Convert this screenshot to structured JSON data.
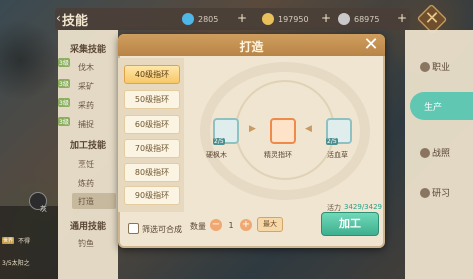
{
  "header": {
    "title": "技能",
    "back_glyph": "‹",
    "currencies": [
      {
        "icon": "diamond-icon",
        "value": "2805",
        "color": "#4fb6e8"
      },
      {
        "icon": "gold-coin-icon",
        "value": "197950",
        "color": "#e8c15a"
      },
      {
        "icon": "silver-coin-icon",
        "value": "68975",
        "color": "#c9c9c9"
      }
    ],
    "plus": "+",
    "close_glyph": "✕"
  },
  "left_menu": {
    "sections": [
      {
        "label": "采集技能",
        "items": [
          {
            "label": "伐木",
            "lv": "3级"
          },
          {
            "label": "采矿",
            "lv": "3级"
          },
          {
            "label": "采药",
            "lv": "3级"
          },
          {
            "label": "捕捉",
            "lv": "3级"
          }
        ]
      },
      {
        "label": "加工技能",
        "items": [
          {
            "label": "烹饪"
          },
          {
            "label": "炼药"
          },
          {
            "label": "打造"
          }
        ]
      },
      {
        "label": "通用技能",
        "items": [
          {
            "label": "钓鱼"
          }
        ]
      }
    ]
  },
  "right_tabs": [
    {
      "label": "职业",
      "icon": "profession-icon"
    },
    {
      "label": "生产",
      "icon": "production-icon",
      "active": true
    },
    {
      "label": "战照",
      "icon": "battle-icon"
    },
    {
      "label": "研习",
      "icon": "study-icon"
    }
  ],
  "chat": {
    "avatar_label": "灰",
    "lines": [
      {
        "tag": "世界",
        "text": "不得"
      },
      {
        "tag": "",
        "text": "3/5太阳之"
      }
    ]
  },
  "modal": {
    "title": "打造",
    "close": "✕",
    "rings": [
      "40级指环",
      "50级指环",
      "60级指环",
      "70级指环",
      "80级指环",
      "90级指环"
    ],
    "active_ring_index": 0,
    "materials": [
      {
        "name": "硬枫木",
        "count": "2/5",
        "icon": "wood-icon"
      },
      {
        "name": "精灵指环",
        "icon": "ring-icon"
      },
      {
        "name": "活血草",
        "count": "2/5",
        "icon": "herb-icon"
      }
    ],
    "energy_label": "活力",
    "energy_value": "3429/3429",
    "filter_label": "筛选可合成",
    "qty_label": "数量",
    "qty_minus": "−",
    "qty_plus": "+",
    "qty_value": "1",
    "max_label": "最大",
    "craft_label": "加工"
  }
}
